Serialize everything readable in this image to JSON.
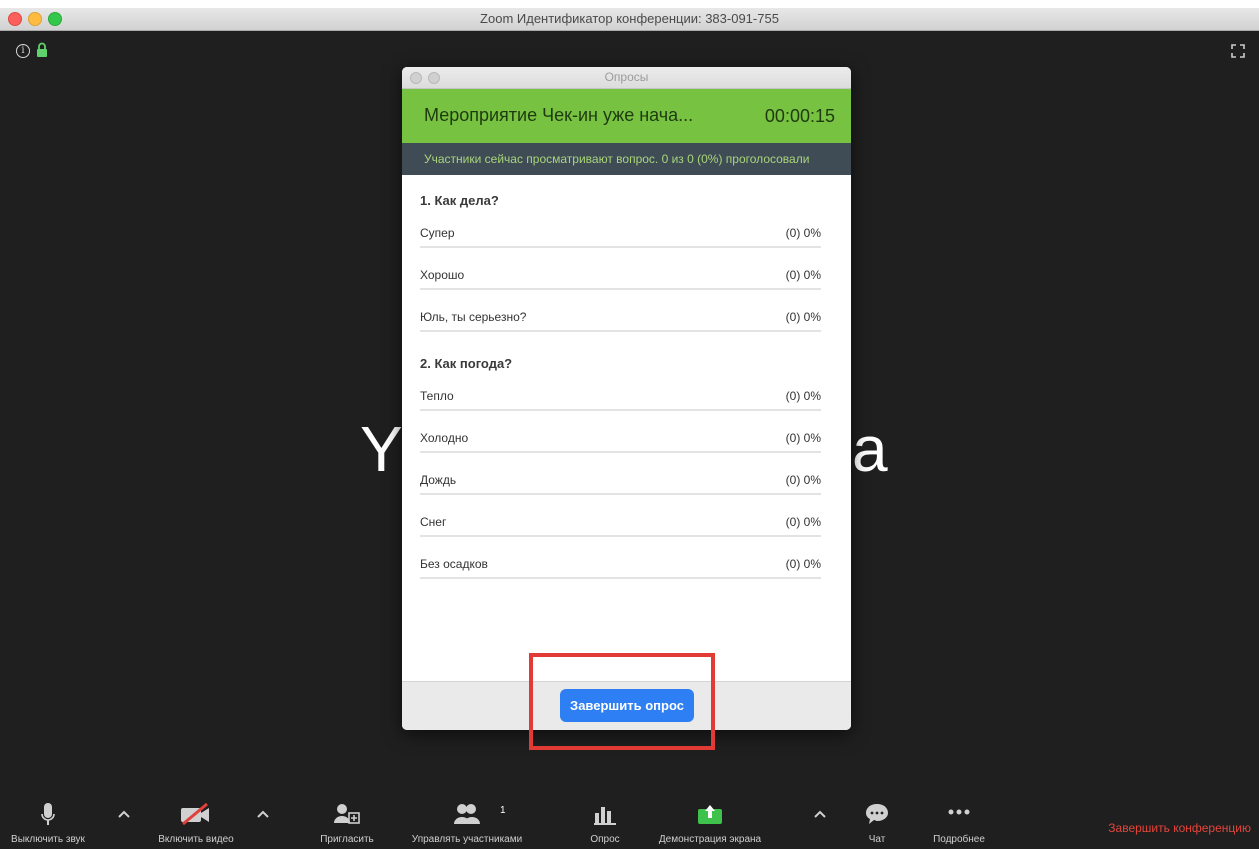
{
  "window": {
    "title": "Zoom Идентификатор конференции: 383-091-755"
  },
  "participant_name": {
    "left": "Y",
    "right": "a"
  },
  "poll": {
    "window_title": "Опросы",
    "name": "Мероприятие Чек-ин уже нача...",
    "timer": "00:00:15",
    "status": "Участники сейчас просматривают вопрос. 0 из 0 (0%) проголосовали",
    "questions": [
      {
        "title": "1. Как дела?",
        "answers": [
          {
            "label": "Супер",
            "result": "(0) 0%"
          },
          {
            "label": "Хорошо",
            "result": "(0) 0%"
          },
          {
            "label": "Юль, ты серьезно?",
            "result": "(0) 0%"
          }
        ]
      },
      {
        "title": "2. Как погода?",
        "answers": [
          {
            "label": "Тепло",
            "result": "(0) 0%"
          },
          {
            "label": "Холодно",
            "result": "(0) 0%"
          },
          {
            "label": "Дождь",
            "result": "(0) 0%"
          },
          {
            "label": "Снег",
            "result": "(0) 0%"
          },
          {
            "label": "Без осадков",
            "result": "(0) 0%"
          }
        ]
      }
    ],
    "end_button": "Завершить опрос"
  },
  "toolbar": {
    "mute": "Выключить звук",
    "video": "Включить видео",
    "invite": "Пригласить",
    "participants": "Управлять участниками",
    "participants_count": "1",
    "poll": "Опрос",
    "share": "Демонстрация экрана",
    "chat": "Чат",
    "more": "Подробнее",
    "end": "Завершить конференцию"
  },
  "colors": {
    "poll_header": "#77c241",
    "status_bar": "#3f4c56",
    "end_button": "#2d7ff3",
    "highlight": "#e23b35",
    "end_meeting": "#e4453b"
  }
}
